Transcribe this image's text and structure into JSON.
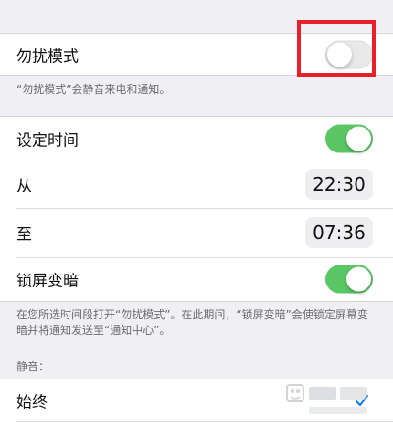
{
  "dnd": {
    "label": "勿扰模式",
    "toggle_on": false,
    "footnote": "“勿扰模式”会静音来电和通知。"
  },
  "schedule": {
    "scheduled_label": "设定时间",
    "scheduled_on": true,
    "from_label": "从",
    "from_time": "22:30",
    "to_label": "至",
    "to_time": "07:36",
    "dim_label": "锁屏变暗",
    "dim_on": true,
    "footnote": "在您所选时间段打开“勿扰模式”。在此期间，“锁屏变暗”会使锁定屏幕变暗并将通知发送至“通知中心”。"
  },
  "silence": {
    "header": "静音：",
    "always_label": "始终",
    "always_selected": true
  },
  "colors": {
    "toggle_on": "#5ac764",
    "highlight": "#e8202a",
    "checkmark": "#007aff"
  },
  "icons": {
    "checkmark": "checkmark-icon",
    "watermark": "baidu-watermark-icon"
  }
}
